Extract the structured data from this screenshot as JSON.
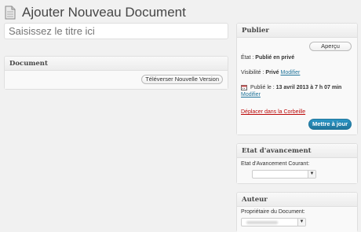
{
  "page": {
    "title": "Ajouter Nouveau Document"
  },
  "title_input": {
    "placeholder": "Saisissez le titre ici"
  },
  "document_box": {
    "header": "Document",
    "upload_button": "Téléverser Nouvelle Version"
  },
  "publish_box": {
    "header": "Publier",
    "preview_button": "Aperçu",
    "status_label": "État :",
    "status_value": "Publié en privé",
    "visibility_label": "Visibilité :",
    "visibility_value": "Privé",
    "visibility_link": "Modifier",
    "published_label": "Publié le :",
    "published_value": "13 avril 2013 à 7 h 07 min",
    "published_link": "Modifier",
    "trash_link": "Déplacer dans la Corbeille",
    "update_button": "Mettre à jour"
  },
  "progress_box": {
    "header": "Etat d'avancement",
    "label": "Etat d'Avancement Courant:",
    "selected": ""
  },
  "author_box": {
    "header": "Auteur",
    "label": "Propriétaire du Document:",
    "selected": ""
  },
  "icons": {
    "document": "document-icon",
    "calendar": "calendar-icon",
    "dropdown": "chevron-down-icon"
  },
  "colors": {
    "accent": "#21759b",
    "trash": "#bc0b0b"
  }
}
